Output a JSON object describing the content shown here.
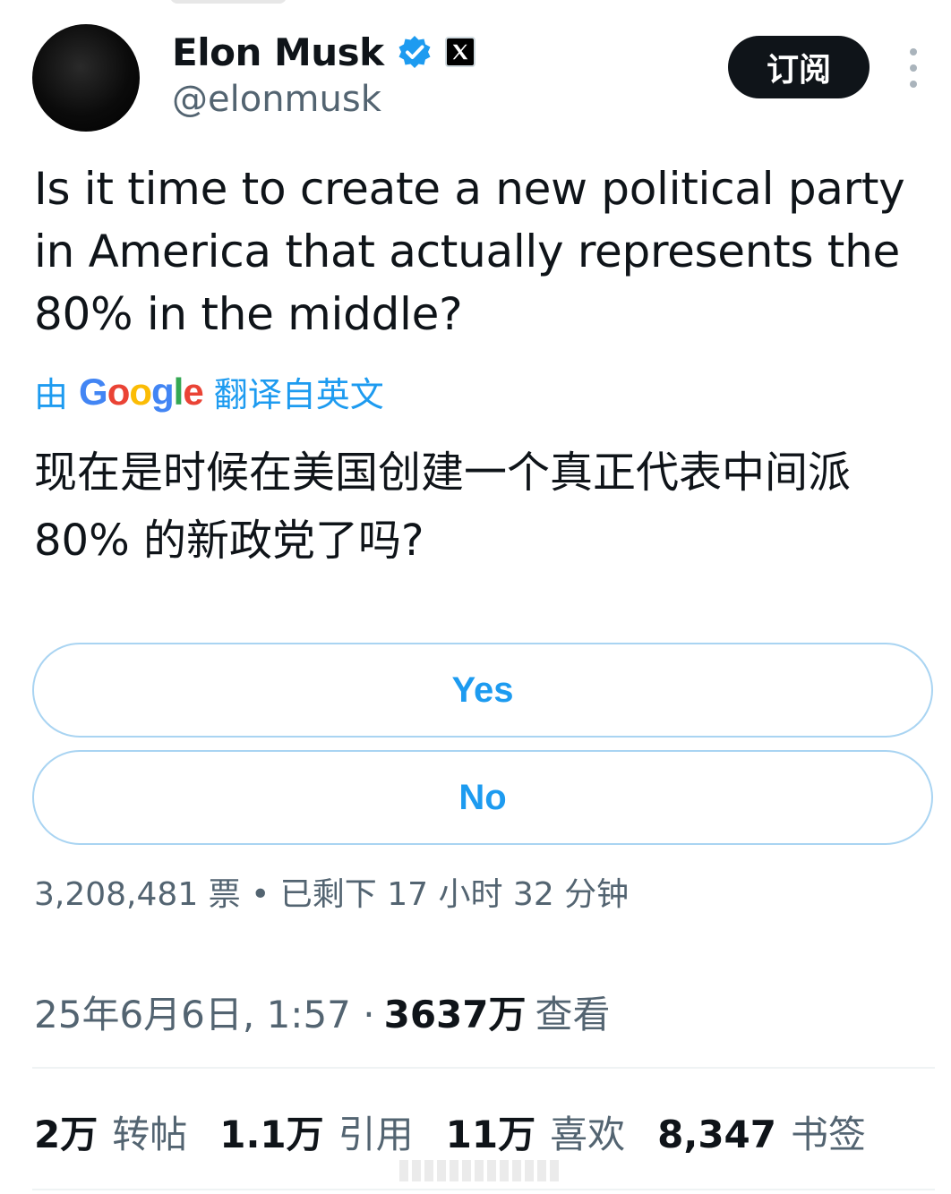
{
  "author": {
    "name": "Elon Musk",
    "handle": "@elonmusk",
    "verified_icon": "verified-badge-icon",
    "affiliation_icon": "x-logo-icon"
  },
  "header": {
    "subscribe_label": "订阅",
    "more_icon": "more-vertical-icon"
  },
  "tweet": {
    "text": "Is it time to create a new political party in America that actually represents the 80% in the middle?",
    "translation_prefix": "由",
    "translation_provider": "Google",
    "translation_suffix": "翻译自英文",
    "translated_text": "现在是时候在美国创建一个真正代表中间派 80% 的新政党了吗?"
  },
  "poll": {
    "options": [
      {
        "label": "Yes"
      },
      {
        "label": "No"
      }
    ],
    "meta": "3,208,481 票 • 已剩下 17 小时 32 分钟"
  },
  "timestamp": {
    "date_time": "25年6月6日, 1:57 ·",
    "views_count": "3637万",
    "views_label": "查看"
  },
  "stats": [
    {
      "count": "2万",
      "label": "转帖"
    },
    {
      "count": "1.1万",
      "label": "引用"
    },
    {
      "count": "11万",
      "label": "喜欢"
    },
    {
      "count": "8,347",
      "label": "书签"
    }
  ],
  "colors": {
    "accent": "#1d9bf0",
    "text_primary": "#0f1419",
    "text_secondary": "#536471",
    "poll_border": "#a9d4f2",
    "button_dark": "#0f1419"
  }
}
